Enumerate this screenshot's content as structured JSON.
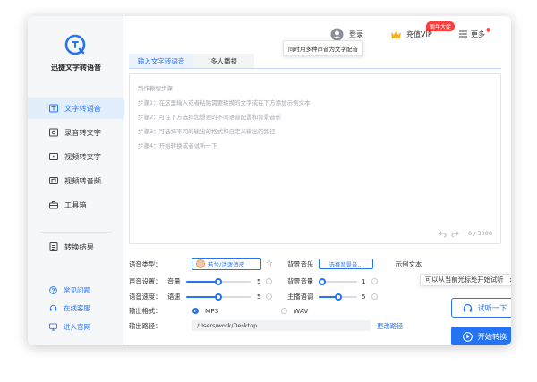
{
  "app": {
    "name": "迅捷文字转语音"
  },
  "window_controls": {
    "colors": [
      "#ff5f57",
      "#febc2e",
      "#28c840"
    ]
  },
  "sidebar": {
    "items": [
      {
        "label": "文字转语音",
        "icon": "text-to-speech-icon",
        "active": true
      },
      {
        "label": "录音转文字",
        "icon": "record-icon",
        "active": false
      },
      {
        "label": "视频转文字",
        "icon": "video-icon",
        "active": false
      },
      {
        "label": "视频转音频",
        "icon": "video-audio-icon",
        "active": false
      },
      {
        "label": "工具箱",
        "icon": "toolbox-icon",
        "active": false
      },
      {
        "label": "转换结果",
        "icon": "result-icon",
        "active": false
      }
    ],
    "bottom_links": [
      {
        "label": "常见问题",
        "icon": "question-icon"
      },
      {
        "label": "在线客服",
        "icon": "headset-icon"
      },
      {
        "label": "进入官网",
        "icon": "monitor-icon"
      }
    ]
  },
  "header": {
    "login_label": "登录",
    "vip_label": "充值VIP",
    "vip_badge": "周年大促",
    "more_label": "更多"
  },
  "tooltip": "同时用多种声音为文字配音",
  "tabs": [
    {
      "label": "输入文字转语音",
      "active": true
    },
    {
      "label": "多人播报",
      "active": false
    }
  ],
  "editor": {
    "lines": [
      "制作教程步骤",
      "步骤1：在这里输入或者粘贴需要转换的文字或在下方添加示例文本",
      "步骤2：可在下方选择您想要的不同语音配置和背景音乐",
      "步骤3：可选择不同的输出的格式和自定义输出的路径",
      "步骤4：开始转换或者试听一下"
    ],
    "char_count": "0 / 3000"
  },
  "settings": {
    "voice_type_label": "语音类型：",
    "voice_name": "若兮/活泼俏皮",
    "bgm_label": "背景音乐",
    "bgm_button": "选择背景音...",
    "sample_label": "示例文本",
    "sample_popup": "可以从当前光标处开始试听",
    "sound_settings_label": "声音设置：",
    "volume_label": "音量",
    "volume_value": "5",
    "volume_fraction": 0.5,
    "bg_volume_label": "背景音量",
    "bg_volume_value": "1",
    "bg_volume_fraction": 0.1,
    "speed_settings_label": "语音速度：",
    "speed_label": "语速",
    "speed_value": "5",
    "speed_fraction": 0.5,
    "host_label": "主播语调",
    "host_value": "5",
    "host_fraction": 0.5,
    "output_format_label": "输出格式：",
    "format_mp3": "MP3",
    "format_wav": "WAV",
    "output_path_label": "输出路径：",
    "output_path": "/Users/work/Desktop",
    "change_path": "更改路径"
  },
  "buttons": {
    "preview": "试听一下",
    "start": "开始转换"
  },
  "colors": {
    "accent": "#2473f2",
    "badge": "#ff3b3b"
  }
}
